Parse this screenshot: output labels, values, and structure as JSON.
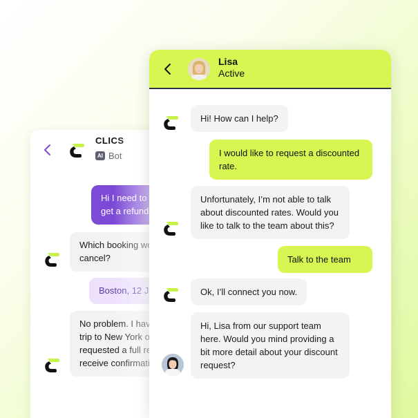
{
  "colors": {
    "accent": "#d8f651",
    "bot_purple": "#7c4ad6",
    "lavender": "#ece0fb",
    "bubble_grey": "#f3f3f4",
    "logo_lime": "#c6f24a",
    "logo_black": "#111111"
  },
  "icons": {
    "back": "chevron-left-icon",
    "logo": "clics-logo-icon",
    "ai": "ai-badge-icon"
  },
  "bot_window": {
    "brand": "CLICS",
    "ai_badge": "AI",
    "role": "Bot",
    "messages": {
      "m1": "Hi I need to c",
      "m1b": "get a refund",
      "m2": "Which booking wo",
      "m2b": "cancel?",
      "m3": "Boston, 12 Ja",
      "m4": "No problem. I hav",
      "m4b": "trip to New York o",
      "m4c": "requested a full re",
      "m4d": "receive confirmati"
    }
  },
  "agent_window": {
    "name": "Lisa",
    "status": "Active",
    "messages": {
      "m1": "Hi! How can I help?",
      "m2a": "I would like to request a discounted",
      "m2b": "rate.",
      "m3a": "Unfortunately, I’m not able to talk",
      "m3b": "about discounted rates. Would you",
      "m3c": "like to talk to the team about this?",
      "m4": "Talk to the team",
      "m5": "Ok, I’ll connect you now.",
      "m6a": "Hi, Lisa from our support team",
      "m6b": "here. Would you mind providing a",
      "m6c": "bit more detail about your discount",
      "m6d": "request?"
    }
  }
}
